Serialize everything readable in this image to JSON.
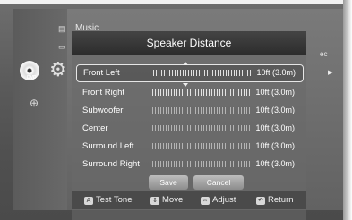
{
  "background": {
    "menu_music": "Music",
    "menu_right_fragment": "ec"
  },
  "icons": {
    "disc_label": "DVD"
  },
  "dialog": {
    "title": "Speaker Distance",
    "rows": [
      {
        "label": "Front Left",
        "value": "10ft (3.0m)",
        "selected": true
      },
      {
        "label": "Front Right",
        "value": "10ft (3.0m)"
      },
      {
        "label": "Subwoofer",
        "value": "10ft (3.0m)"
      },
      {
        "label": "Center",
        "value": "10ft (3.0m)"
      },
      {
        "label": "Surround Left",
        "value": "10ft (3.0m)"
      },
      {
        "label": "Surround Right",
        "value": "10ft (3.0m)"
      }
    ],
    "save_label": "Save",
    "cancel_label": "Cancel"
  },
  "help": {
    "test_tone_key": "A",
    "test_tone": "Test Tone",
    "move": "Move",
    "adjust": "Adjust",
    "return": "Return"
  }
}
